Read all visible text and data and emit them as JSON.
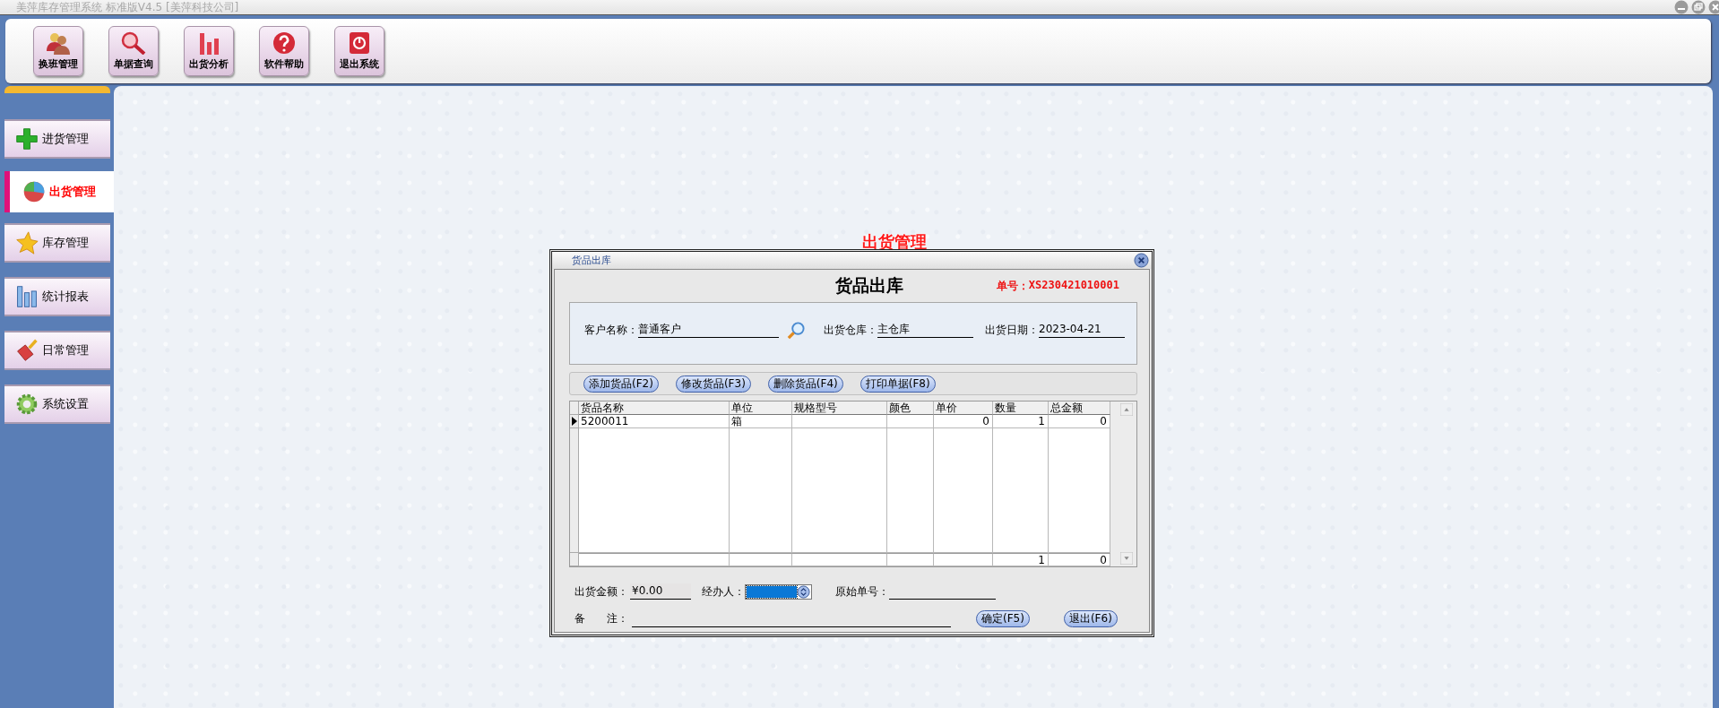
{
  "window": {
    "title": "美萍库存管理系统 标准版V4.5 [美萍科技公司]"
  },
  "toolbar": [
    {
      "label": "换班管理"
    },
    {
      "label": "单据查询"
    },
    {
      "label": "出货分析"
    },
    {
      "label": "软件帮助"
    },
    {
      "label": "退出系统"
    }
  ],
  "sidebar": {
    "items": [
      {
        "label": "进货管理",
        "selected": false
      },
      {
        "label": "出货管理",
        "selected": true
      },
      {
        "label": "库存管理",
        "selected": false
      },
      {
        "label": "统计报表",
        "selected": false
      },
      {
        "label": "日常管理",
        "selected": false
      },
      {
        "label": "系统设置",
        "selected": false
      }
    ]
  },
  "main": {
    "heading": "出货管理"
  },
  "dialog": {
    "title": "货品出库",
    "heading": "货品出库",
    "order_label": "单号：",
    "order_no": "XS230421010001",
    "customer": {
      "label": "客户名称：",
      "value": "普通客户"
    },
    "warehouse": {
      "label": "出货仓库：",
      "value": "主仓库"
    },
    "date": {
      "label": "出货日期：",
      "value": "2023-04-21"
    },
    "actions": [
      "添加货品(F2)",
      "修改货品(F3)",
      "删除货品(F4)",
      "打印单据(F8)"
    ],
    "table": {
      "columns": [
        "货品名称",
        "单位",
        "规格型号",
        "颜色",
        "单价",
        "数量",
        "总金额"
      ],
      "rows": [
        {
          "name": "5200011",
          "unit": "箱",
          "price": "0",
          "quantity": "1",
          "total": "0",
          "selected": true
        }
      ],
      "footer": {
        "quantity": "1",
        "total": "0"
      }
    },
    "amount": {
      "label": "出货金额：",
      "value": "¥0.00"
    },
    "handler": {
      "label": "经办人：",
      "focused": true
    },
    "original_no": {
      "label": "原始单号："
    },
    "note": {
      "label_first": "备",
      "label_second": "注："
    },
    "buttons": [
      "确定(F5)",
      "退出(F6)"
    ]
  }
}
